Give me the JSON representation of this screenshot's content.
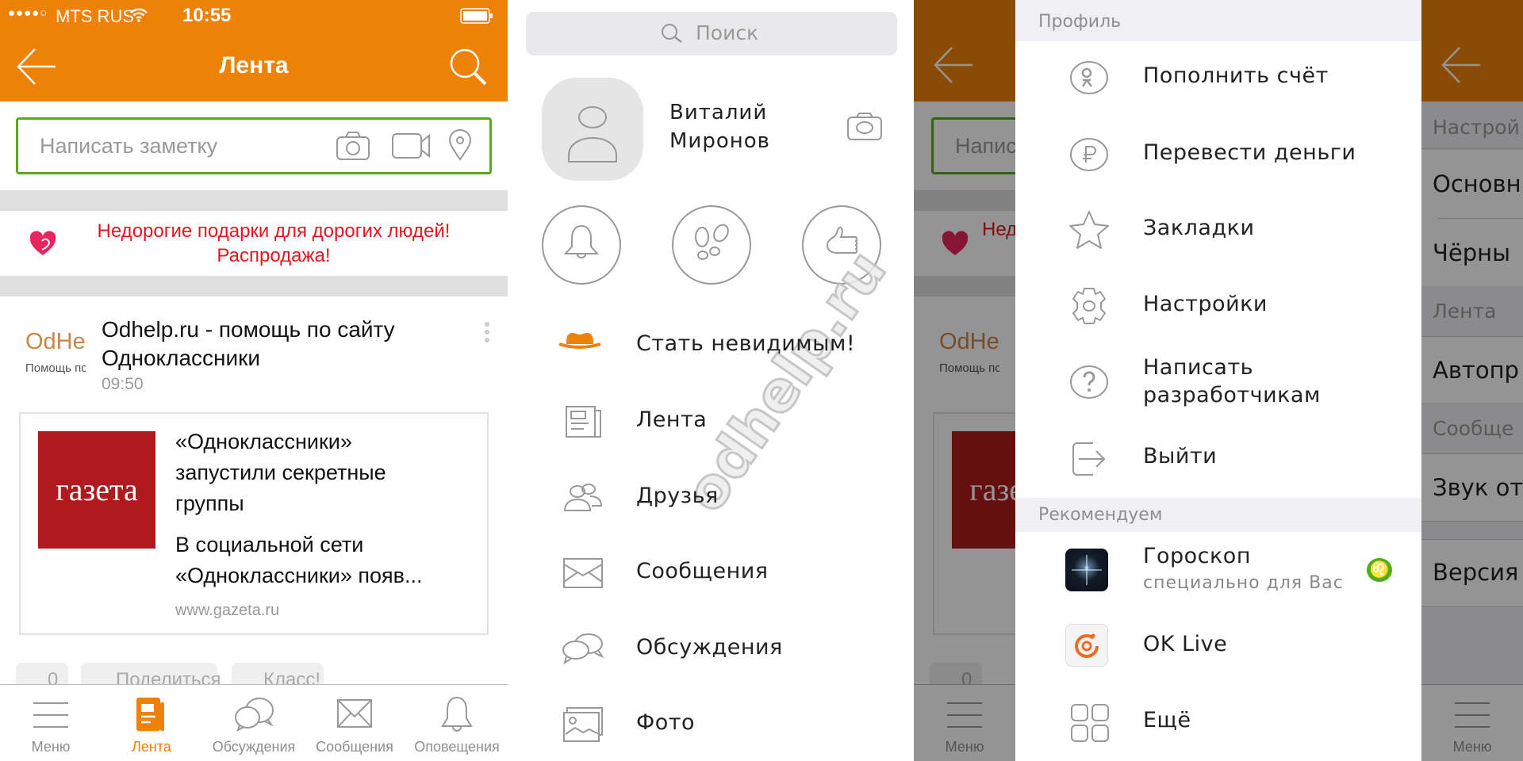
{
  "status_bar": {
    "signal": "●●●●○",
    "carrier": "MTS RUS",
    "time": "10:55"
  },
  "feed": {
    "title": "Лента",
    "note_placeholder": "Написать заметку",
    "ad_line1": "Недорогие подарки для дорогих людей!",
    "ad_line2": "Распродажа!",
    "post": {
      "logo_text": "OdHe",
      "logo_sub": "Помощь пс",
      "author_line1": "Odhelp.ru - помощь по сайту",
      "author_line2": "Одноклассники",
      "time": "09:50",
      "card_image_text": "газета",
      "card_title_lines": [
        "«Одноклассники»",
        "запустили секретные",
        "группы"
      ],
      "card_desc_lines": [
        "В социальной сети",
        "«Одноклассники» появ..."
      ],
      "card_url": "www.gazeta.ru",
      "comments_count": "0",
      "share_label": "Поделиться",
      "like_label": "Класс!"
    },
    "tabs": [
      {
        "label": "Меню",
        "icon": "menu-icon",
        "active": false
      },
      {
        "label": "Лента",
        "icon": "feed-icon",
        "active": true
      },
      {
        "label": "Обсуждения",
        "icon": "discussions-icon",
        "active": false
      },
      {
        "label": "Сообщения",
        "icon": "messages-icon",
        "active": false
      },
      {
        "label": "Оповещения",
        "icon": "notifications-icon",
        "active": false
      }
    ]
  },
  "side_menu": {
    "search_placeholder": "Поиск",
    "user_first": "Виталий",
    "user_last": "Миронов",
    "quick_icons": [
      "bell-icon",
      "footprints-icon",
      "thumbs-up-icon"
    ],
    "items": [
      {
        "label": "Стать невидимым!",
        "icon": "hat-icon"
      },
      {
        "label": "Лента",
        "icon": "newspaper-icon"
      },
      {
        "label": "Друзья",
        "icon": "friends-icon"
      },
      {
        "label": "Сообщения",
        "icon": "envelope-icon"
      },
      {
        "label": "Обсуждения",
        "icon": "discussions-icon"
      },
      {
        "label": "Фото",
        "icon": "photo-icon"
      }
    ],
    "watermark": "odhelp.ru"
  },
  "profile_menu": {
    "section_profile": "Профиль",
    "items": [
      {
        "label": "Пополнить счёт",
        "icon": "ok-coin-icon"
      },
      {
        "label": "Перевести деньги",
        "icon": "ruble-icon"
      },
      {
        "label": "Закладки",
        "icon": "star-icon"
      },
      {
        "label": "Настройки",
        "icon": "gear-icon"
      },
      {
        "label": "Написать",
        "label2": "разработчикам",
        "icon": "question-icon"
      },
      {
        "label": "Выйти",
        "icon": "logout-icon"
      }
    ],
    "section_recommend": "Рекомендуем",
    "apps": [
      {
        "title": "Гороскоп",
        "subtitle": "специально для Вас",
        "icon": "horoscope-icon",
        "badge": "♌"
      },
      {
        "title": "OK Live",
        "icon": "ok-live-icon"
      },
      {
        "title": "Ещё",
        "icon": "grid-icon"
      }
    ]
  },
  "settings": {
    "rows": [
      {
        "type": "section",
        "label": "Настрой"
      },
      {
        "type": "row",
        "label": "Основн"
      },
      {
        "type": "row",
        "label": "Чёрны"
      },
      {
        "type": "section",
        "label": "Лента"
      },
      {
        "type": "row",
        "label": "Автопр"
      },
      {
        "type": "section",
        "label": "Сообще"
      },
      {
        "type": "row",
        "label": "Звук от"
      },
      {
        "type": "row",
        "label": "Версия"
      }
    ],
    "tab_label": "Меню"
  },
  "colors": {
    "brand": "#EE8208",
    "accent_green": "#5AAA1E",
    "ad_red": "#E8141E",
    "gazeta_red": "#AE1A1E"
  }
}
